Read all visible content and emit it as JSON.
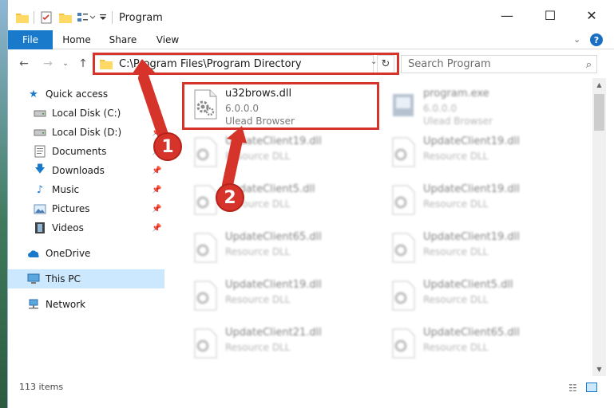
{
  "window": {
    "title": "Program",
    "minimize_glyph": "—",
    "maximize_glyph": "☐",
    "close_glyph": "✕"
  },
  "ribbon": {
    "tabs": [
      {
        "label": "File"
      },
      {
        "label": "Home"
      },
      {
        "label": "Share"
      },
      {
        "label": "View"
      }
    ],
    "help_glyph": "?"
  },
  "address": {
    "path": "C:\\Program Files\\Program Directory"
  },
  "search": {
    "placeholder": "Search Program"
  },
  "navigation": {
    "items": [
      {
        "label": "Quick access",
        "icon": "star-icon"
      },
      {
        "label": "Local Disk (C:)",
        "icon": "drive-icon"
      },
      {
        "label": "Local Disk (D:)",
        "icon": "drive-icon"
      },
      {
        "label": "Documents",
        "icon": "documents-icon"
      },
      {
        "label": "Downloads",
        "icon": "download-icon"
      },
      {
        "label": "Music",
        "icon": "music-icon"
      },
      {
        "label": "Pictures",
        "icon": "pictures-icon"
      },
      {
        "label": "Videos",
        "icon": "videos-icon"
      },
      {
        "label": "OneDrive",
        "icon": "cloud-icon"
      },
      {
        "label": "This PC",
        "icon": "computer-icon"
      },
      {
        "label": "Network",
        "icon": "network-icon"
      }
    ]
  },
  "files": [
    {
      "name": "u32brows.dll",
      "line1": "6.0.0.0",
      "line2": "Ulead Browser"
    },
    {
      "name": "program.exe",
      "line1": "6.0.0.0",
      "line2": "Ulead Browser"
    },
    {
      "name": "UpdateClient19.dll",
      "line1": "Resource DLL"
    },
    {
      "name": "UpdateClient19.dll",
      "line1": "Resource DLL"
    },
    {
      "name": "UpdateClient5.dll",
      "line1": "Resource DLL"
    },
    {
      "name": "UpdateClient19.dll",
      "line1": "Resource DLL"
    },
    {
      "name": "UpdateClient65.dll",
      "line1": "Resource DLL"
    },
    {
      "name": "UpdateClient19.dll",
      "line1": "Resource DLL"
    },
    {
      "name": "UpdateClient19.dll",
      "line1": "Resource DLL"
    },
    {
      "name": "UpdateClient5.dll",
      "line1": "Resource DLL"
    },
    {
      "name": "UpdateClient21.dll",
      "line1": "Resource DLL"
    },
    {
      "name": "UpdateClient65.dll",
      "line1": "Resource DLL"
    }
  ],
  "status": {
    "item_count": "113 items"
  },
  "annotations": {
    "badge1": "1",
    "badge2": "2",
    "color": "#d6342b"
  },
  "colors": {
    "accent": "#1979ca",
    "selected": "#cce8ff"
  }
}
